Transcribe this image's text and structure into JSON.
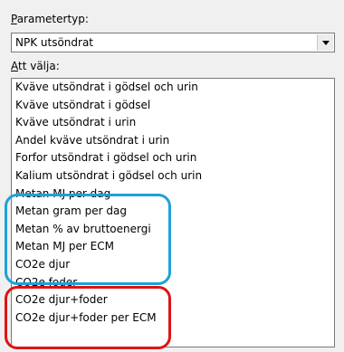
{
  "parameter_label_first": "P",
  "parameter_label_rest": "arametertyp:",
  "parameter_value": "NPK utsöndrat",
  "choose_label_first": "A",
  "choose_label_rest": "tt välja:",
  "items": [
    "Kväve utsöndrat i gödsel och urin",
    "Kväve utsöndrat i gödsel",
    "Kväve utsöndrat i urin",
    "Andel kväve utsöndrat i urin",
    "Forfor utsöndrat i gödsel och urin",
    "Kalium utsöndrat i gödsel och urin",
    "Metan MJ per dag",
    "Metan gram per dag",
    "Metan % av bruttoenergi",
    "Metan MJ per ECM",
    "CO2e djur",
    "CO2e foder",
    "CO2e djur+foder",
    "CO2e djur+foder per ECM"
  ],
  "colors": {
    "highlight_blue": "#1ea1d8",
    "highlight_red": "#dd1414"
  },
  "icons": {
    "dropdown": "chevron-down-icon"
  }
}
